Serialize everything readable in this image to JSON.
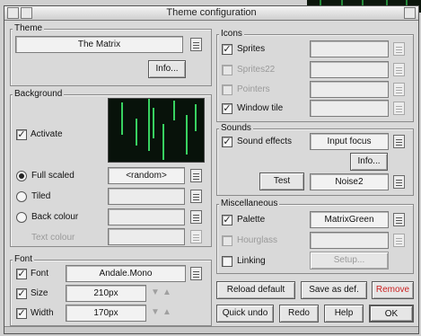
{
  "window": {
    "title": "Theme configuration"
  },
  "theme": {
    "title": "Theme",
    "value": "The Matrix",
    "info_label": "Info..."
  },
  "background": {
    "title": "Background",
    "activate_label": "Activate",
    "activate_checked": true,
    "full_scaled_label": "Full scaled",
    "full_scaled_value": "<random>",
    "tiled_label": "Tiled",
    "back_colour_label": "Back colour",
    "text_colour_label": "Text colour"
  },
  "font": {
    "title": "Font",
    "font_label": "Font",
    "font_value": "Andale.Mono",
    "size_label": "Size",
    "size_value": "210px",
    "width_label": "Width",
    "width_value": "170px"
  },
  "icons": {
    "title": "Icons",
    "sprites_label": "Sprites",
    "sprites22_label": "Sprites22",
    "pointers_label": "Pointers",
    "window_tile_label": "Window tile"
  },
  "sounds": {
    "title": "Sounds",
    "sound_effects_label": "Sound effects",
    "sound_effects_value": "Input focus",
    "info_label": "Info...",
    "test_label": "Test",
    "test_value": "Noise2"
  },
  "misc": {
    "title": "Miscellaneous",
    "palette_label": "Palette",
    "palette_value": "MatrixGreen",
    "hourglass_label": "Hourglass",
    "linking_label": "Linking",
    "setup_label": "Setup..."
  },
  "actions": {
    "reload_label": "Reload default",
    "save_label": "Save as def.",
    "remove_label": "Remove",
    "quick_undo_label": "Quick undo",
    "redo_label": "Redo",
    "help_label": "Help",
    "ok_label": "OK"
  },
  "colors": {
    "accent_red": "#cc2222",
    "matrix_green": "#38d160"
  },
  "icons_meta": {
    "check_glyph": "✓",
    "arrow_down": "▼",
    "arrow_up": "▲"
  }
}
